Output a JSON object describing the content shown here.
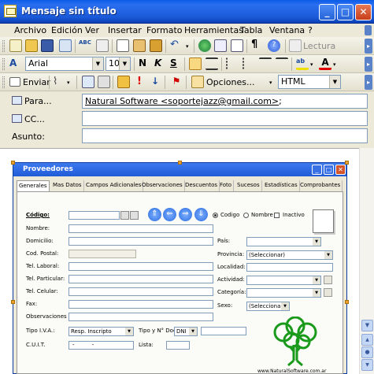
{
  "window": {
    "title": "Mensaje sin título"
  },
  "menu": [
    {
      "label": "Archivo"
    },
    {
      "label": "Edición"
    },
    {
      "label": "Ver"
    },
    {
      "label": "Insertar"
    },
    {
      "label": "Formato"
    },
    {
      "label": "Herramientas"
    },
    {
      "label": "Tabla"
    },
    {
      "label": "Ventana"
    },
    {
      "label": "?"
    }
  ],
  "toolbar1": {
    "lectura_label": "Lectura"
  },
  "format": {
    "font": "Arial",
    "size": "10",
    "bold": "N",
    "italic": "K",
    "strike": "S"
  },
  "mail_toolbar": {
    "send_label": "Enviar",
    "options_label": "Opciones...",
    "format": "HTML"
  },
  "header": {
    "to_label": "Para...",
    "to_value": "Natural Software <soportejazz@gmail.com>",
    "to_suffix": ";",
    "cc_label": "CC...",
    "cc_value": "",
    "subject_label": "Asunto:",
    "subject_value": ""
  },
  "pasted_app": {
    "title": "Proveedores",
    "tabs": [
      "Generales",
      "Mas Datos",
      "Campos Adicionales",
      "Observaciones",
      "Descuentos",
      "Foto",
      "Sucesos",
      "Estadísticas",
      "Comprobantes"
    ],
    "search": {
      "label": "Código:",
      "options": [
        "Codigo",
        "Nombre",
        "Inactivo"
      ]
    },
    "left_fields": [
      "Nombre:",
      "Domicilio:",
      "Cod. Postal:",
      "Tel. Laboral:",
      "Tel. Particular:",
      "Tel. Celular:",
      "Fax:",
      "Observaciones"
    ],
    "right_fields": {
      "pais": "País:",
      "provincia": "Provincia:",
      "provincia_value": "(Seleccionar)",
      "localidad": "Localidad:",
      "actividad": "Actividad:",
      "categoria": "Categoría:",
      "sexo": "Sexo:",
      "sexo_value": "(Seleccionar)"
    },
    "tipo_iva": {
      "label": "Tipo I.V.A.:",
      "value": "Resp. Inscripto"
    },
    "tipo_doc": {
      "label": "Tipo y N° Doc",
      "value": "DNI"
    },
    "cuit": {
      "label": "C.U.I.T.",
      "value": "-          -"
    },
    "lista": {
      "label": "Lista:"
    },
    "logo_url": "www.NaturalSoftware.com.ar"
  },
  "colors": {
    "titlebar": "#1b5ad8",
    "accent": "#0a3ca0",
    "logo": "#1a9a1a"
  }
}
